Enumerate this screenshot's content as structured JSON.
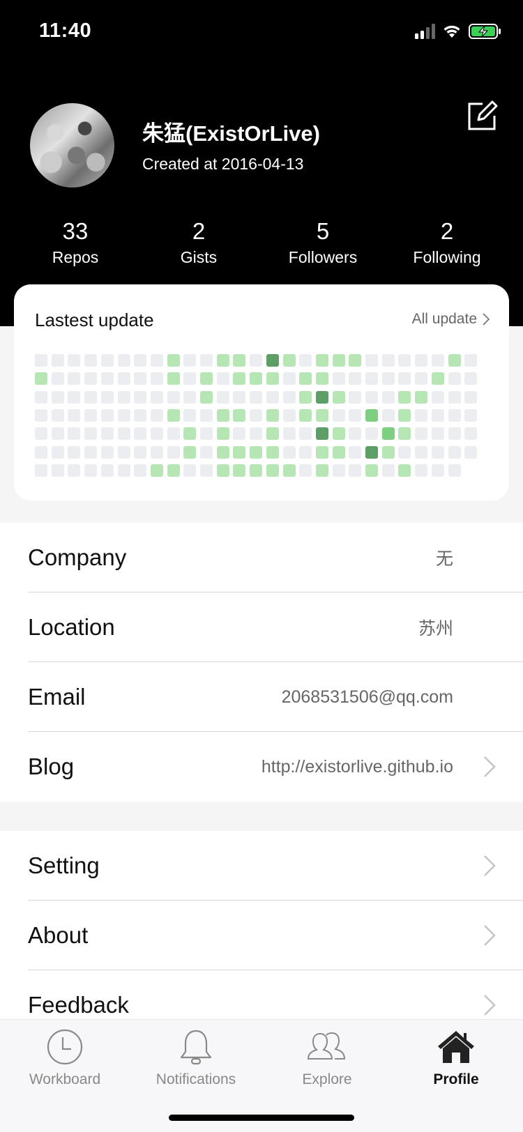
{
  "status_bar": {
    "time": "11:40"
  },
  "profile": {
    "name": "朱猛(ExistOrLive)",
    "created": "Created at 2016-04-13"
  },
  "stats": [
    {
      "count": "33",
      "label": "Repos"
    },
    {
      "count": "2",
      "label": "Gists"
    },
    {
      "count": "5",
      "label": "Followers"
    },
    {
      "count": "2",
      "label": "Following"
    }
  ],
  "contributions": {
    "title": "Lastest update",
    "link_label": "All update",
    "colors": {
      "0": "#ebedf0",
      "1": "#b5e6b3",
      "2": "#7fcf83",
      "3": "#5c9e65"
    },
    "columns": [
      [
        0,
        1,
        0,
        0,
        0,
        0,
        0
      ],
      [
        0,
        0,
        0,
        0,
        0,
        0,
        0
      ],
      [
        0,
        0,
        0,
        0,
        0,
        0,
        0
      ],
      [
        0,
        0,
        0,
        0,
        0,
        0,
        0
      ],
      [
        0,
        0,
        0,
        0,
        0,
        0,
        0
      ],
      [
        0,
        0,
        0,
        0,
        0,
        0,
        0
      ],
      [
        0,
        0,
        0,
        0,
        0,
        0,
        0
      ],
      [
        0,
        0,
        0,
        0,
        0,
        0,
        1
      ],
      [
        1,
        1,
        0,
        1,
        0,
        0,
        1
      ],
      [
        0,
        0,
        0,
        0,
        1,
        1,
        0
      ],
      [
        0,
        1,
        1,
        0,
        0,
        0,
        0
      ],
      [
        1,
        0,
        0,
        1,
        1,
        1,
        1
      ],
      [
        1,
        1,
        0,
        1,
        0,
        1,
        1
      ],
      [
        0,
        1,
        0,
        0,
        0,
        1,
        1
      ],
      [
        3,
        1,
        0,
        1,
        1,
        1,
        1
      ],
      [
        1,
        0,
        0,
        0,
        0,
        0,
        1
      ],
      [
        0,
        1,
        1,
        1,
        0,
        0,
        0
      ],
      [
        1,
        1,
        3,
        1,
        3,
        1,
        1
      ],
      [
        1,
        0,
        1,
        0,
        1,
        1,
        0
      ],
      [
        1,
        0,
        0,
        0,
        0,
        0,
        0
      ],
      [
        0,
        0,
        0,
        2,
        0,
        3,
        1
      ],
      [
        0,
        0,
        0,
        0,
        2,
        1,
        0
      ],
      [
        0,
        0,
        1,
        1,
        1,
        0,
        1
      ],
      [
        0,
        0,
        1,
        0,
        0,
        0,
        0
      ],
      [
        0,
        1,
        0,
        0,
        0,
        0,
        0
      ],
      [
        1,
        0,
        0,
        0,
        0,
        0,
        0
      ],
      [
        0,
        0,
        0,
        0,
        0,
        0,
        null
      ]
    ]
  },
  "info_rows": [
    {
      "label": "Company",
      "value": "无"
    },
    {
      "label": "Location",
      "value": "苏州"
    },
    {
      "label": "Email",
      "value": "2068531506@qq.com"
    },
    {
      "label": "Blog",
      "value": "http://existorlive.github.io"
    }
  ],
  "menu_rows": [
    {
      "label": "Setting"
    },
    {
      "label": "About"
    },
    {
      "label": "Feedback"
    }
  ],
  "tabs": [
    {
      "label": "Workboard",
      "icon": "clock-icon"
    },
    {
      "label": "Notifications",
      "icon": "bell-icon"
    },
    {
      "label": "Explore",
      "icon": "people-icon"
    },
    {
      "label": "Profile",
      "icon": "home-icon",
      "active": true
    }
  ]
}
